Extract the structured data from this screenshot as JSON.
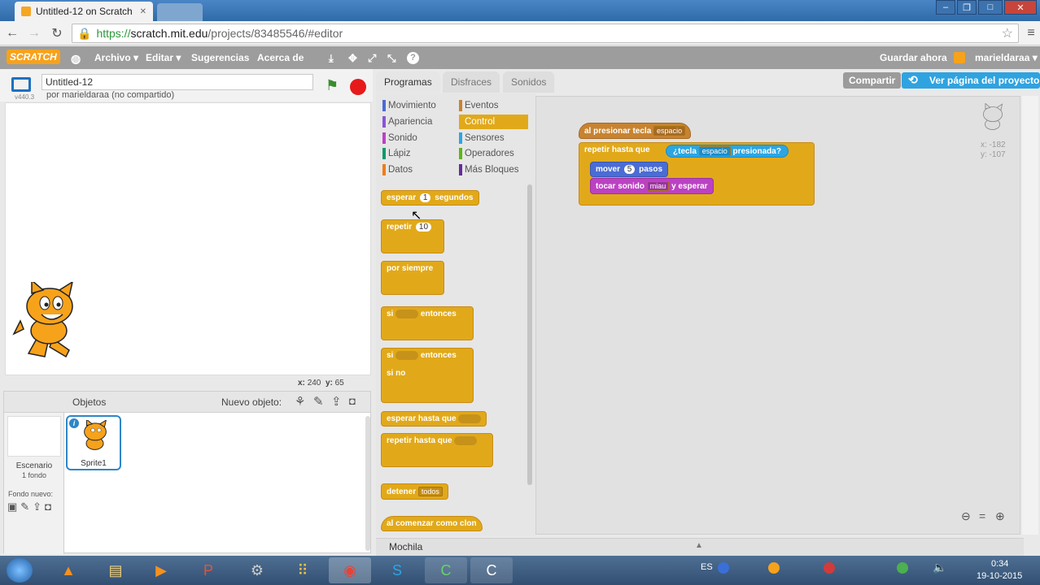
{
  "browser": {
    "tab_title": "Untitled-12 on Scratch",
    "tab_close": "✕",
    "url_scheme": "https://",
    "url_host": "scratch.mit.edu",
    "url_path": "/projects/83485546/#editor"
  },
  "menu": {
    "logo": "SCRATCH",
    "items": [
      "Archivo ▾",
      "Editar ▾",
      "Sugerencias",
      "Acerca de"
    ],
    "save_now": "Guardar ahora",
    "user": "marieldaraa ▾"
  },
  "stage_header": {
    "project_title": "Untitled-12",
    "author": "por marieldaraa (no compartido)",
    "version": "v440.3"
  },
  "stage": {
    "coords_x_label": "x:",
    "coords_x": "240",
    "coords_y_label": "y:",
    "coords_y": "65"
  },
  "sprites": {
    "header": "Objetos",
    "new_object": "Nuevo objeto:",
    "stage_label": "Escenario",
    "stage_sub": "1 fondo",
    "new_backdrop": "Fondo nuevo:",
    "sprite_name": "Sprite1"
  },
  "tabs": [
    "Programas",
    "Disfraces",
    "Sonidos"
  ],
  "share_button": "Compartir",
  "project_page_button": "Ver página del proyecto",
  "categories": [
    {
      "label": "Movimiento",
      "color": "#4a6cd4"
    },
    {
      "label": "Eventos",
      "color": "#c88330"
    },
    {
      "label": "Apariencia",
      "color": "#8a55d7"
    },
    {
      "label": "Control",
      "color": "#e1a91a"
    },
    {
      "label": "Sonido",
      "color": "#bb42c3"
    },
    {
      "label": "Sensores",
      "color": "#2ca5e2"
    },
    {
      "label": "Lápiz",
      "color": "#0e9a6c"
    },
    {
      "label": "Operadores",
      "color": "#5cb712"
    },
    {
      "label": "Datos",
      "color": "#ee7d16"
    },
    {
      "label": "Más Bloques",
      "color": "#632d99"
    }
  ],
  "palette_blocks": {
    "wait_a": "esperar",
    "wait_n": "1",
    "wait_b": "segundos",
    "repeat": "repetir",
    "repeat_n": "10",
    "forever": "por siempre",
    "if_a": "si",
    "if_b": "entonces",
    "ifelse_a": "si",
    "ifelse_b": "entonces",
    "ifelse_else": "si no",
    "wait_until": "esperar hasta que",
    "repeat_until": "repetir hasta que",
    "stop": "detener",
    "stop_dd": "todos",
    "clone_start": "al comenzar como clon"
  },
  "script": {
    "hat_a": "al presionar tecla",
    "hat_key": "espacio",
    "loop_a": "repetir hasta que",
    "sense_a": "¿tecla",
    "sense_key": "espacio",
    "sense_b": "presionada?",
    "move_a": "mover",
    "move_n": "5",
    "move_b": "pasos",
    "sound_a": "tocar sonido",
    "sound_dd": "miau",
    "sound_b": "y esperar"
  },
  "sprite_info": {
    "x": "x: -182",
    "y": "y: -107"
  },
  "backpack": "Mochila",
  "taskbar": {
    "lang": "ES",
    "time": "0:34",
    "date": "19-10-2015"
  }
}
